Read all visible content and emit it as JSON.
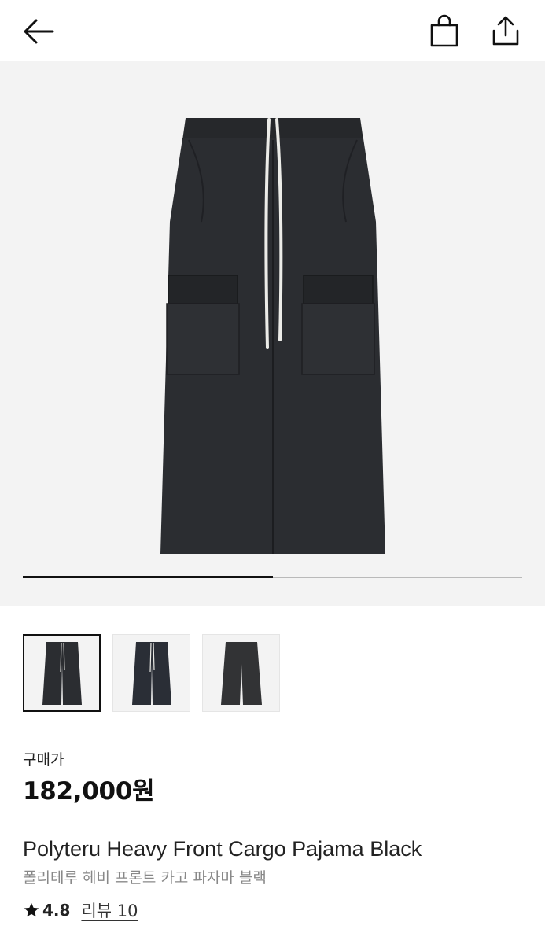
{
  "header": {
    "back_icon": "arrow-left-icon",
    "bag_icon": "shopping-bag-icon",
    "share_icon": "share-upload-icon"
  },
  "gallery": {
    "background": "#f3f3f3",
    "progress_fraction": 0.5,
    "thumbnails": [
      {
        "selected": true
      },
      {
        "selected": false
      },
      {
        "selected": false
      }
    ]
  },
  "product": {
    "price_label": "구매가",
    "price": "182,000원",
    "name_en": "Polyteru Heavy Front Cargo Pajama Black",
    "name_ko": "폴리테루 헤비 프론트 카고 파자마 블랙",
    "rating": "4.8",
    "review_link": "리뷰 10"
  },
  "colors": {
    "accent": "#111111",
    "muted_text": "#888888"
  }
}
